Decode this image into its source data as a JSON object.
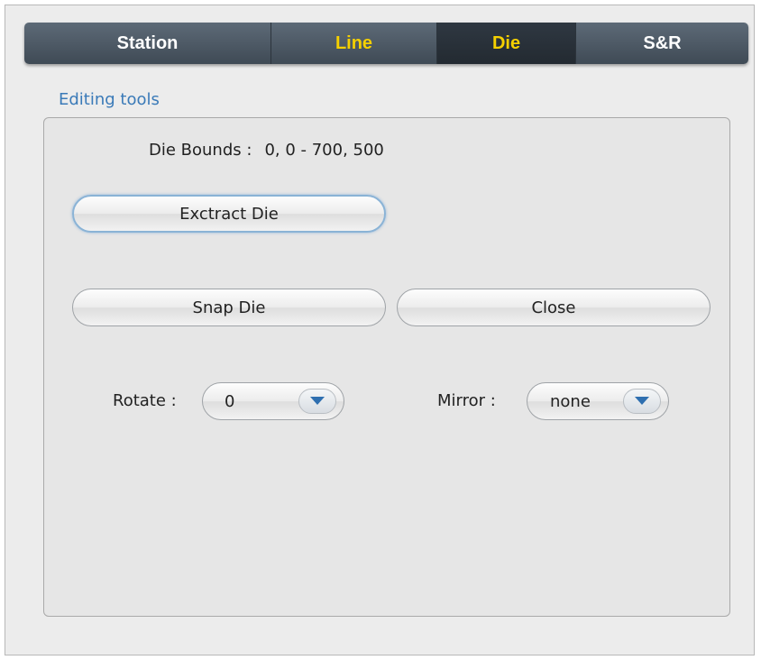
{
  "tabs": [
    {
      "label": "Station",
      "color": "#ffffff"
    },
    {
      "label": "Line",
      "color": "#f5d000"
    },
    {
      "label": "Die",
      "color": "#f5d000",
      "active": true
    },
    {
      "label": "S&R",
      "color": "#ffffff"
    }
  ],
  "group": {
    "title": "Editing tools",
    "title_color": "#3a7ab8"
  },
  "bounds": {
    "label": "Die Bounds :",
    "value": "0, 0 - 700, 500"
  },
  "buttons": {
    "extract": "Exctract Die",
    "snap": "Snap Die",
    "close": "Close"
  },
  "rotate": {
    "label": "Rotate :",
    "value": "0",
    "icon": "chevron-down-icon"
  },
  "mirror": {
    "label": "Mirror :",
    "value": "none",
    "icon": "chevron-down-icon"
  },
  "colors": {
    "arrow": "#2e6fb0"
  }
}
